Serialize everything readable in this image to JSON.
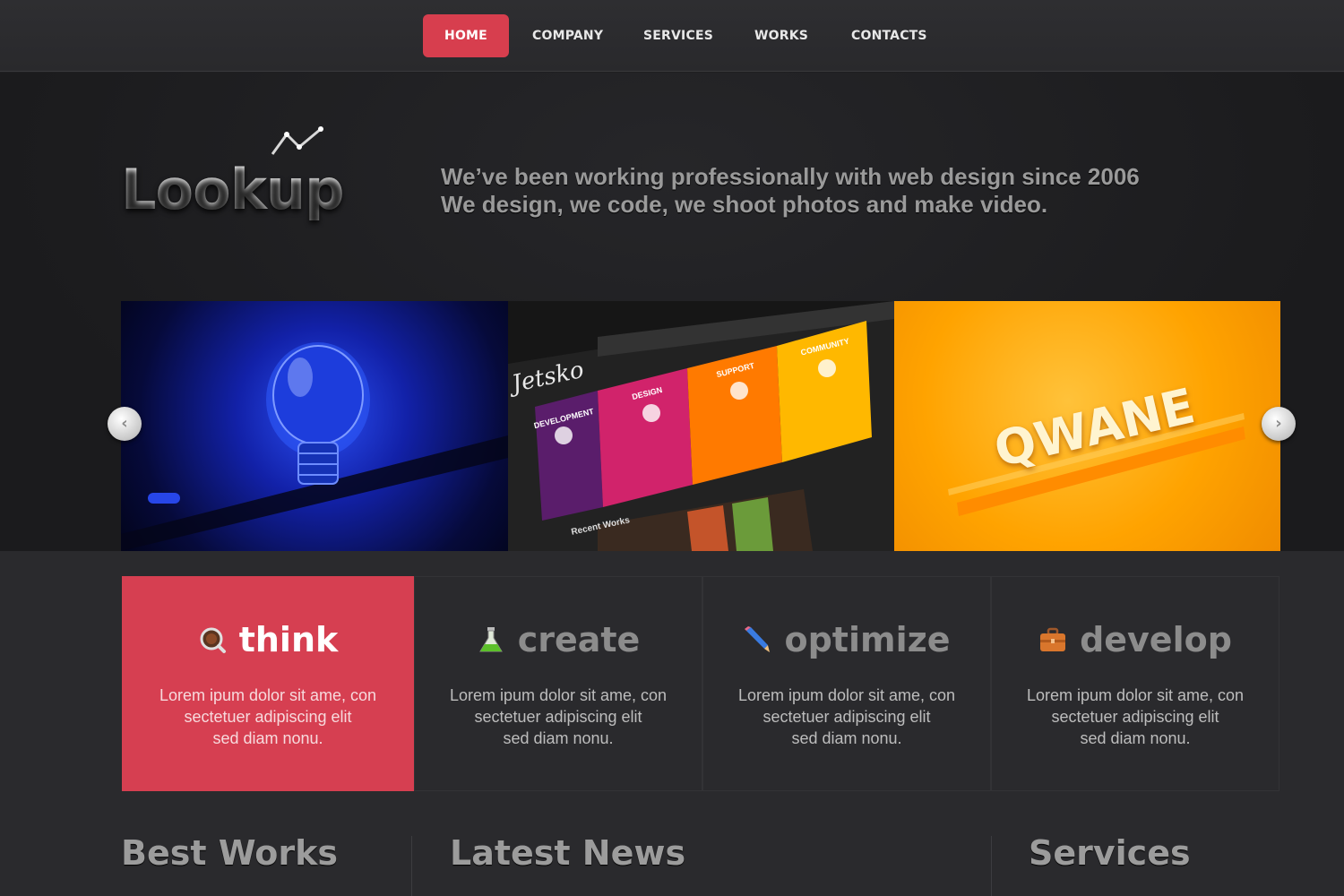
{
  "nav": {
    "items": [
      {
        "label": "HOME"
      },
      {
        "label": "COMPANY"
      },
      {
        "label": "SERVICES"
      },
      {
        "label": "WORKS"
      },
      {
        "label": "CONTACTS"
      }
    ],
    "active_index": 0
  },
  "header": {
    "logo": "Lookup",
    "tagline_line1": "We’ve been working professionally with web design since 2006",
    "tagline_line2": "We design, we code, we shoot photos and make video."
  },
  "slider": {
    "slides": [
      {
        "label": ""
      },
      {
        "label": "Jetsko",
        "tiles": [
          "DEVELOPMENT",
          "DESIGN",
          "SUPPORT",
          "COMMUNITY"
        ],
        "caption": "Recent Works"
      },
      {
        "label": "QWANE"
      }
    ],
    "prev_icon": "chevron-left-icon",
    "next_icon": "chevron-right-icon"
  },
  "features": [
    {
      "title": "think",
      "icon": "magnifier-icon",
      "text1": "Lorem ipum dolor sit ame, con",
      "text2": "sectetuer adipiscing elit",
      "text3": "sed diam nonu."
    },
    {
      "title": "create",
      "icon": "flask-icon",
      "text1": "Lorem ipum dolor sit ame, con",
      "text2": "sectetuer adipiscing elit",
      "text3": "sed diam nonu."
    },
    {
      "title": "optimize",
      "icon": "pencil-icon",
      "text1": "Lorem ipum dolor sit ame, con",
      "text2": "sectetuer adipiscing elit",
      "text3": "sed diam nonu."
    },
    {
      "title": "develop",
      "icon": "briefcase-icon",
      "text1": "Lorem ipum dolor sit ame, con",
      "text2": "sectetuer adipiscing elit",
      "text3": "sed diam nonu."
    }
  ],
  "sections": {
    "best_works": "Best Works",
    "latest_news": "Latest News",
    "services": "Services"
  },
  "colors": {
    "accent": "#d63f51",
    "background": "#1f1f21"
  }
}
